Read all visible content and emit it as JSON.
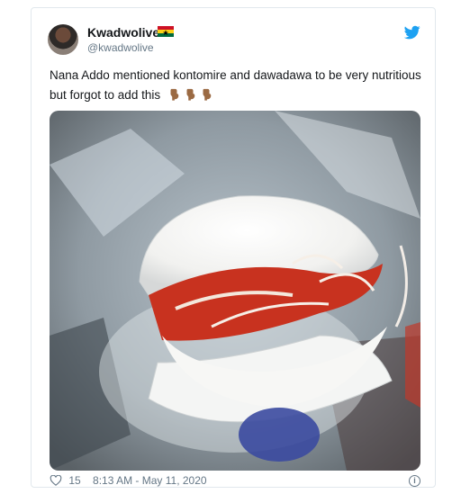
{
  "tweet": {
    "display_name": "Kwadwolive",
    "handle": "@kwadwolive",
    "text": "Nana Addo mentioned kontomire and dawadawa to be very nutritious but forgot to add this",
    "emojis": [
      "point-down-emoji",
      "point-down-emoji",
      "point-down-emoji"
    ],
    "like_count": "15",
    "timestamp": "8:13 AM - May 11, 2020",
    "info_label": "i"
  },
  "icons": {
    "brand": "twitter-bird-icon",
    "flag": "ghana-flag-icon",
    "like": "heart-icon",
    "info": "info-icon"
  },
  "colors": {
    "twitter_blue": "#1da1f2",
    "text": "#14171a",
    "muted": "#657786",
    "border": "#e1e8ed"
  }
}
